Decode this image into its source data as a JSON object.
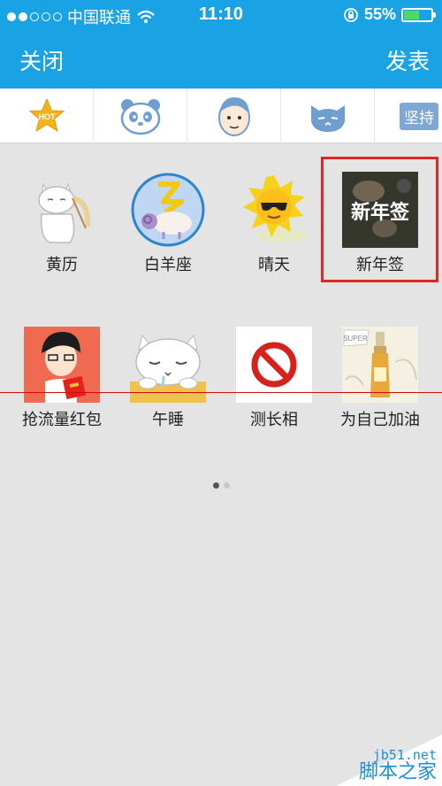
{
  "status_bar": {
    "carrier": "中国联通",
    "time": "11:10",
    "battery": "55%",
    "battery_level": 0.55
  },
  "nav": {
    "close_label": "关闭",
    "post_label": "发表"
  },
  "tabs": [
    {
      "icon": "hot-star-icon",
      "text": "HOT"
    },
    {
      "icon": "panda-icon"
    },
    {
      "icon": "boy-face-icon"
    },
    {
      "icon": "cat-face-icon"
    },
    {
      "icon": "text-sticker-icon",
      "text": "坚持"
    }
  ],
  "items": [
    {
      "label": "黄历",
      "icon": "white-cat-meditating-icon"
    },
    {
      "label": "白羊座",
      "icon": "aries-sheep-icon"
    },
    {
      "label": "晴天",
      "icon": "sun-sunglasses-icon"
    },
    {
      "label": "新年签",
      "icon": "new-year-lot-icon",
      "overlay_text": "新年签"
    },
    {
      "label": "抢流量红包",
      "icon": "red-envelope-boy-icon"
    },
    {
      "label": "午睡",
      "icon": "sleeping-cat-icon"
    },
    {
      "label": "测长相",
      "icon": "prohibited-sign-icon"
    },
    {
      "label": "为自己加油",
      "icon": "oil-bottle-icon",
      "overlay_text": "SUPER"
    }
  ],
  "pager": {
    "pages": 2,
    "current": 1
  },
  "watermark": {
    "site": "jb51.net",
    "name": "脚本之家"
  }
}
